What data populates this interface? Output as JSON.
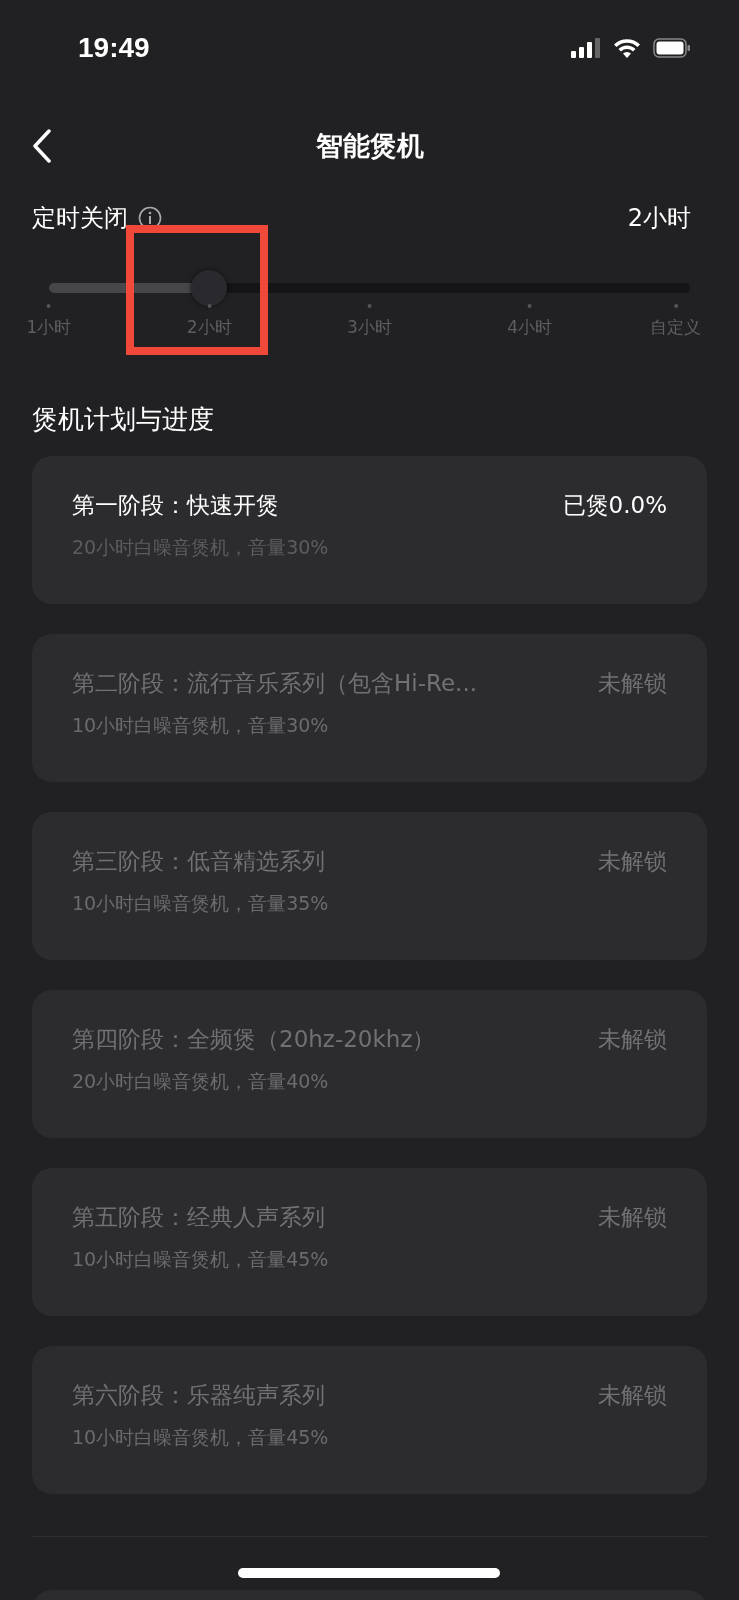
{
  "status_bar": {
    "time": "19:49"
  },
  "nav": {
    "title": "智能煲机"
  },
  "timer": {
    "label": "定时关闭",
    "value": "2小时",
    "slider": {
      "level": 0.25,
      "ticks": [
        "1小时",
        "2小时",
        "3小时",
        "4小时",
        "自定义"
      ]
    }
  },
  "section_title": "煲机计划与进度",
  "stages": [
    {
      "name": "第一阶段：快速开煲",
      "status": "已煲0.0%",
      "detail": "20小时白噪音煲机，音量30%",
      "locked": false
    },
    {
      "name": "第二阶段：流行音乐系列（包含Hi-Re...",
      "status": "未解锁",
      "detail": "10小时白噪音煲机，音量30%",
      "locked": true
    },
    {
      "name": "第三阶段：低音精选系列",
      "status": "未解锁",
      "detail": "10小时白噪音煲机，音量35%",
      "locked": true
    },
    {
      "name": "第四阶段：全频煲（20hz-20khz）",
      "status": "未解锁",
      "detail": "20小时白噪音煲机，音量40%",
      "locked": true
    },
    {
      "name": "第五阶段：经典人声系列",
      "status": "未解锁",
      "detail": "10小时白噪音煲机，音量45%",
      "locked": true
    },
    {
      "name": "第六阶段：乐器纯声系列",
      "status": "未解锁",
      "detail": "10小时白噪音煲机，音量45%",
      "locked": true
    }
  ]
}
